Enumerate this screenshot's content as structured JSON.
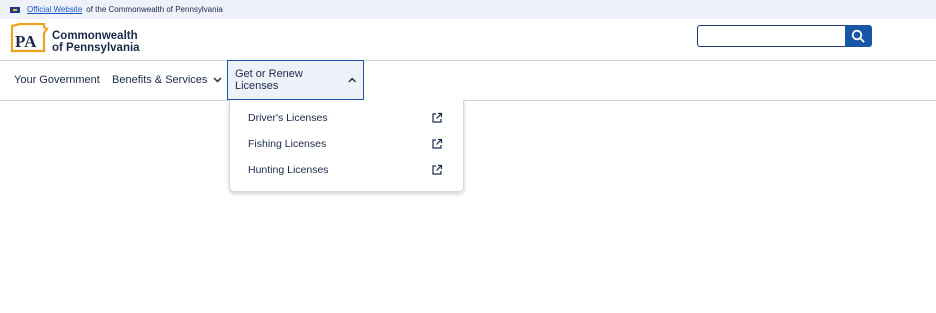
{
  "official_bar": {
    "link_text": "Official Website",
    "rest_text": "of the Commonwealth of Pennsylvania"
  },
  "logo": {
    "mark": "PA",
    "line1": "Commonwealth",
    "line2": "of Pennsylvania",
    "color_outline": "#f0a11f",
    "color_text": "#1b2a4a"
  },
  "search": {
    "value": "",
    "placeholder": "",
    "icon": "search-icon",
    "button_color": "#1756a5"
  },
  "nav": {
    "items": [
      {
        "label": "Your Government"
      },
      {
        "label": "Benefits & Services",
        "icon": "chevron-down-icon"
      },
      {
        "label": "Get or Renew Licenses",
        "icon": "chevron-up-icon",
        "expanded": true
      }
    ]
  },
  "dropdown": {
    "items": [
      {
        "label": "Driver's Licenses",
        "icon": "external-link-icon"
      },
      {
        "label": "Fishing Licenses",
        "icon": "external-link-icon"
      },
      {
        "label": "Hunting Licenses",
        "icon": "external-link-icon"
      }
    ]
  }
}
